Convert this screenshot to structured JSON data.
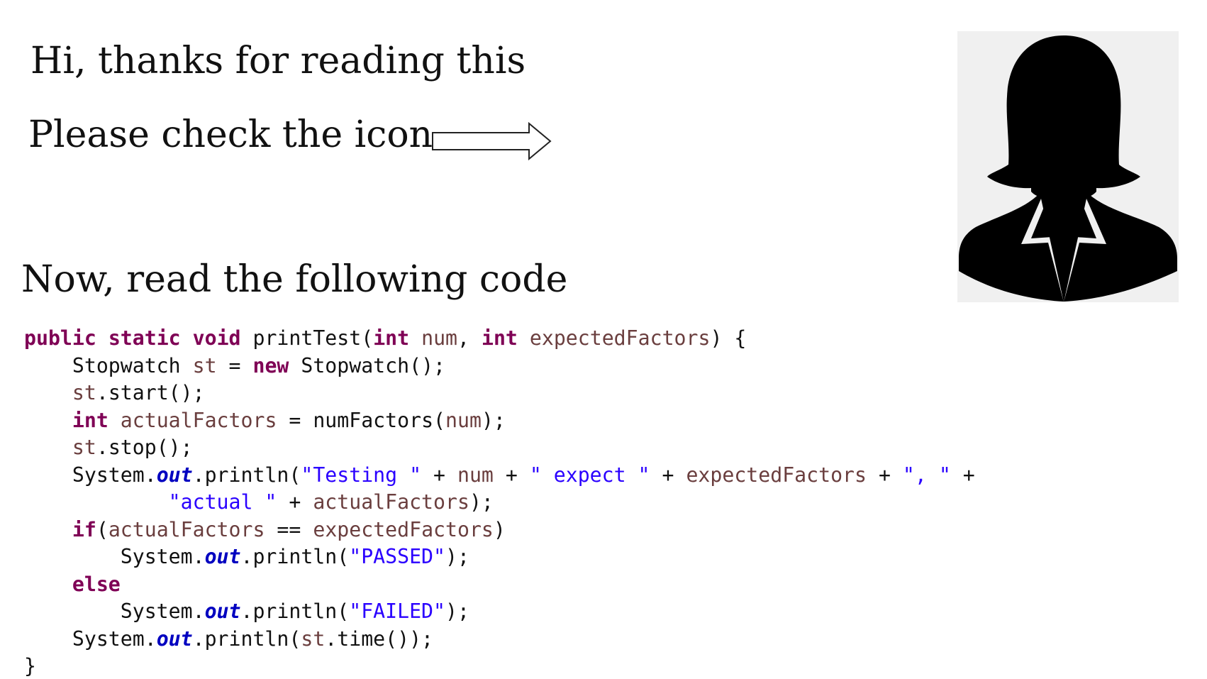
{
  "headings": {
    "greeting": "Hi, thanks for reading this",
    "instruction": "Please check the icon",
    "code_intro": "Now, read the following code"
  },
  "icons": {
    "arrow": "right-arrow-outline-icon",
    "avatar": "businesswoman-silhouette-icon"
  },
  "colors": {
    "keyword": "#7f0055",
    "variable": "#6a3e3e",
    "string": "#2a00ff",
    "field": "#0000c0",
    "text": "#111111",
    "avatar_background": "#f0f0f0"
  },
  "code": {
    "language": "java",
    "lines": [
      [
        [
          "kw",
          "public"
        ],
        [
          "plain",
          " "
        ],
        [
          "kw",
          "static"
        ],
        [
          "plain",
          " "
        ],
        [
          "kw",
          "void"
        ],
        [
          "plain",
          " printTest("
        ],
        [
          "kw",
          "int"
        ],
        [
          "plain",
          " "
        ],
        [
          "var",
          "num"
        ],
        [
          "plain",
          ", "
        ],
        [
          "kw",
          "int"
        ],
        [
          "plain",
          " "
        ],
        [
          "var",
          "expectedFactors"
        ],
        [
          "plain",
          ") {"
        ]
      ],
      [
        [
          "plain",
          "    Stopwatch "
        ],
        [
          "var",
          "st"
        ],
        [
          "plain",
          " = "
        ],
        [
          "kw",
          "new"
        ],
        [
          "plain",
          " Stopwatch();"
        ]
      ],
      [
        [
          "plain",
          "    "
        ],
        [
          "var",
          "st"
        ],
        [
          "plain",
          ".start();"
        ]
      ],
      [
        [
          "plain",
          "    "
        ],
        [
          "kw",
          "int"
        ],
        [
          "plain",
          " "
        ],
        [
          "var",
          "actualFactors"
        ],
        [
          "plain",
          " = numFactors("
        ],
        [
          "var",
          "num"
        ],
        [
          "plain",
          ");"
        ]
      ],
      [
        [
          "plain",
          "    "
        ],
        [
          "var",
          "st"
        ],
        [
          "plain",
          ".stop();"
        ]
      ],
      [
        [
          "plain",
          "    System."
        ],
        [
          "fld",
          "out"
        ],
        [
          "plain",
          ".println("
        ],
        [
          "str",
          "\"Testing \""
        ],
        [
          "plain",
          " + "
        ],
        [
          "var",
          "num"
        ],
        [
          "plain",
          " + "
        ],
        [
          "str",
          "\" expect \""
        ],
        [
          "plain",
          " + "
        ],
        [
          "var",
          "expectedFactors"
        ],
        [
          "plain",
          " + "
        ],
        [
          "str",
          "\", \""
        ],
        [
          "plain",
          " +"
        ]
      ],
      [
        [
          "plain",
          "            "
        ],
        [
          "str",
          "\"actual \""
        ],
        [
          "plain",
          " + "
        ],
        [
          "var",
          "actualFactors"
        ],
        [
          "plain",
          ");"
        ]
      ],
      [
        [
          "plain",
          "    "
        ],
        [
          "kw",
          "if"
        ],
        [
          "plain",
          "("
        ],
        [
          "var",
          "actualFactors"
        ],
        [
          "plain",
          " == "
        ],
        [
          "var",
          "expectedFactors"
        ],
        [
          "plain",
          ")"
        ]
      ],
      [
        [
          "plain",
          "        System."
        ],
        [
          "fld",
          "out"
        ],
        [
          "plain",
          ".println("
        ],
        [
          "str",
          "\"PASSED\""
        ],
        [
          "plain",
          ");"
        ]
      ],
      [
        [
          "plain",
          "    "
        ],
        [
          "kw",
          "else"
        ]
      ],
      [
        [
          "plain",
          "        System."
        ],
        [
          "fld",
          "out"
        ],
        [
          "plain",
          ".println("
        ],
        [
          "str",
          "\"FAILED\""
        ],
        [
          "plain",
          ");"
        ]
      ],
      [
        [
          "plain",
          "    System."
        ],
        [
          "fld",
          "out"
        ],
        [
          "plain",
          ".println("
        ],
        [
          "var",
          "st"
        ],
        [
          "plain",
          ".time());"
        ]
      ],
      [
        [
          "plain",
          "}"
        ]
      ]
    ]
  }
}
